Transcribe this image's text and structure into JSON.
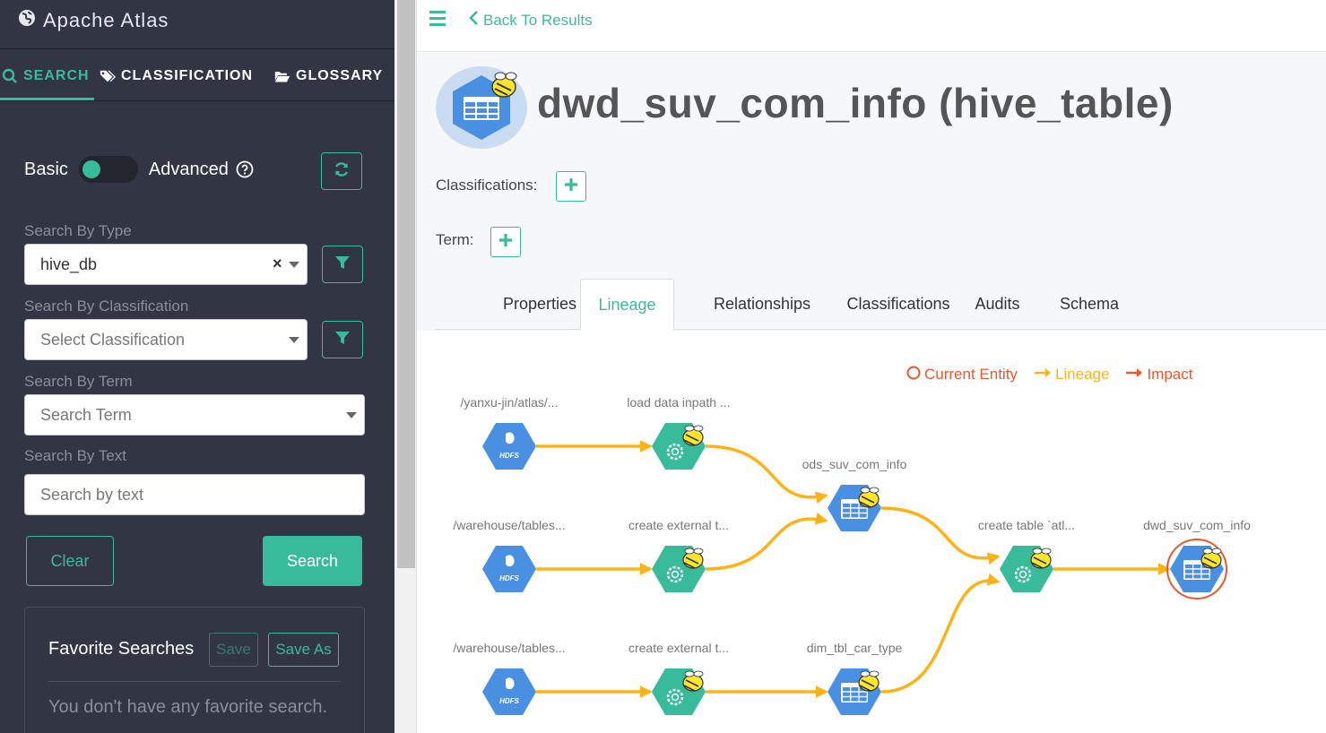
{
  "app": {
    "title": "Apache Atlas"
  },
  "sidebar": {
    "tabs": [
      {
        "label": "SEARCH",
        "icon": "search-icon",
        "active": true
      },
      {
        "label": "CLASSIFICATION",
        "icon": "tags-icon",
        "active": false
      },
      {
        "label": "GLOSSARY",
        "icon": "folder-open-icon",
        "active": false
      }
    ],
    "mode": {
      "basic_label": "Basic",
      "advanced_label": "Advanced"
    },
    "type": {
      "label": "Search By Type",
      "value": "hive_db"
    },
    "classification": {
      "label": "Search By Classification",
      "placeholder": "Select Classification"
    },
    "term": {
      "label": "Search By Term",
      "placeholder": "Search Term"
    },
    "text": {
      "label": "Search By Text",
      "placeholder": "Search by text"
    },
    "clear_label": "Clear",
    "search_label": "Search",
    "favorites": {
      "title": "Favorite Searches",
      "save_label": "Save",
      "save_as_label": "Save As",
      "empty_message": "You don't have any favorite search."
    }
  },
  "topbar": {
    "back_label": "Back To Results"
  },
  "entity": {
    "title": "dwd_suv_com_info (hive_table)",
    "classifications_label": "Classifications:",
    "term_label": "Term:"
  },
  "detail_tabs": [
    {
      "label": "Properties",
      "active": false
    },
    {
      "label": "Lineage",
      "active": true
    },
    {
      "label": "Relationships",
      "active": false
    },
    {
      "label": "Classifications",
      "active": false
    },
    {
      "label": "Audits",
      "active": false
    },
    {
      "label": "Schema",
      "active": false
    }
  ],
  "lineage": {
    "legend": {
      "current_entity": "Current Entity",
      "lineage": "Lineage",
      "impact": "Impact"
    },
    "nodes": [
      {
        "id": "hdfs1",
        "label": "/yanxu-jin/atlas/...",
        "kind": "hdfs"
      },
      {
        "id": "proc1",
        "label": "load data inpath ...",
        "kind": "process"
      },
      {
        "id": "ods",
        "label": "ods_suv_com_info",
        "kind": "table"
      },
      {
        "id": "hdfs2",
        "label": "/warehouse/tables...",
        "kind": "hdfs"
      },
      {
        "id": "proc2",
        "label": "create external t...",
        "kind": "process"
      },
      {
        "id": "proc4",
        "label": "create table `atl...",
        "kind": "process"
      },
      {
        "id": "dwd",
        "label": "dwd_suv_com_info",
        "kind": "table",
        "current": true
      },
      {
        "id": "hdfs3",
        "label": "/warehouse/tables...",
        "kind": "hdfs"
      },
      {
        "id": "proc3",
        "label": "create external t...",
        "kind": "process"
      },
      {
        "id": "dim",
        "label": "dim_tbl_car_type",
        "kind": "table"
      }
    ],
    "edges": [
      [
        "hdfs1",
        "proc1"
      ],
      [
        "proc1",
        "ods"
      ],
      [
        "hdfs2",
        "proc2"
      ],
      [
        "proc2",
        "ods"
      ],
      [
        "ods",
        "proc4"
      ],
      [
        "proc4",
        "dwd"
      ],
      [
        "hdfs3",
        "proc3"
      ],
      [
        "proc3",
        "dim"
      ],
      [
        "dim",
        "proc4"
      ]
    ],
    "hdfs_icon_text": "HDFS"
  },
  "colors": {
    "accent": "#38bb9b",
    "sidebar_bg": "#323544",
    "lineage_edge": "#fdb316",
    "impact": "#e8572d",
    "current_entity_ring": "#e8572d",
    "hex_blue": "#4a90e2",
    "hex_green": "#38bb9b",
    "hive_yellow": "#fde52c"
  }
}
